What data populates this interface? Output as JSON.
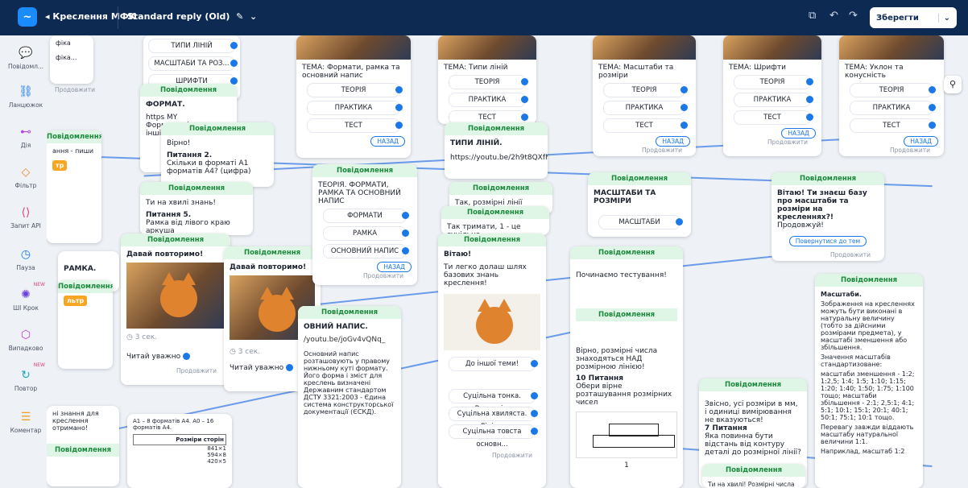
{
  "topbar": {
    "project": "Креслення МФК",
    "bot_name": "Standard reply (Old)",
    "save_label": "Зберегти"
  },
  "sidebar": [
    {
      "label": "Повідомл...",
      "icon": "chat-icon"
    },
    {
      "label": "Ланцюжок",
      "icon": "chain-icon"
    },
    {
      "label": "Дія",
      "icon": "action-icon"
    },
    {
      "label": "Фільтр",
      "icon": "filter-icon"
    },
    {
      "label": "Запит API",
      "icon": "api-icon"
    },
    {
      "label": "Пауза",
      "icon": "pause-icon"
    },
    {
      "label": "ШІ Крок",
      "icon": "ai-icon",
      "badge": "NEW"
    },
    {
      "label": "Випадково",
      "icon": "random-icon"
    },
    {
      "label": "Повтор",
      "icon": "repeat-icon",
      "badge": "NEW"
    },
    {
      "label": "Коментар",
      "icon": "comment-icon"
    }
  ],
  "common": {
    "message_header": "Повідомлення",
    "continue": "Продовжити",
    "back": "НАЗАД",
    "wait_3s": "3 сек."
  },
  "cards": {
    "lines_menu": [
      "ТИПИ ЛІНІЙ",
      "МАСШТАБИ ТА РОЗ...",
      "ШРИФТИ"
    ],
    "format_title": "ФОРМАТ.",
    "format_url": "https MY",
    "format_body": "Форм розмір якому інші ко",
    "vitayu_hint": "Вірно!",
    "q2_title": "Питання 2.",
    "q2_text": "Скільки в форматі А1 форматів А4? (цифра)",
    "on_wave": "Ти на хвилі знань!",
    "q5_title": "Питання 5.",
    "q5_text": "Рамка від лівого краю аркуша",
    "repeat_title": "Давай повторимо!",
    "read_carefully": "Читай уважно",
    "theme_formats": "ТЕМА: Формати, рамка та основний напис",
    "menu_tpt": [
      "ТЕОРІЯ",
      "ПРАКТИКА",
      "ТЕСТ"
    ],
    "theory_formats_title": "ТЕОРІЯ. ФОРМАТИ, РАМКА ТА ОСНОВНИЙ НАПИС",
    "theory_formats_menu": [
      "ФОРМАТИ",
      "РАМКА",
      "ОСНОВНИЙ НАПИС"
    ],
    "theme_lines": "ТЕМА: Типи ліній",
    "lines_types_title": "ТИПИ ЛІНІЙ.",
    "lines_url": "https://youtu.be/2h9t8QXfMl",
    "lines_note": "Так, розмірні лінії показує",
    "lines_note2": "Так тримати, 1 - це суцільна",
    "vitayu": "Вітаю!",
    "vitayu_text": "Ти легко долаш шлях базових знань креслення!",
    "another_topic": "До іншої теми!",
    "line_opts": [
      "Суцільна тонка. Виносні...",
      "Суцільна хвиляста. Лінія...",
      "Суцільна товста основн..."
    ],
    "theme_scale": "ТЕМА: Масштаби та розміри",
    "scale_title": "МАСШТАБИ ТА РОЗМІРИ",
    "scale_btn": "МАСШТАБИ",
    "start_test": "Починаємо тестування!",
    "correct_text": "Вірно, розмірні числа знаходяться НАД розмірною лінією!",
    "q10_title": "10 Питання",
    "q10_text": "Обери вірне розташування розмірних чисел",
    "theme_fonts": "ТЕМА: Шрифти",
    "theme_slope": "ТЕМА: Уклон та конусність",
    "greet_scale": "Вітаю! Ти знаєш базу про масштаби та розміри на кресленнях?!",
    "greet_cont": "Продовжуй!",
    "return_btn": "Повернутися до тем",
    "mm_text": "Звісно, усі розміри в мм, і одиниці вимірювання не вказуються!",
    "q7_title": "7 Питання",
    "q7_text": "Яка повинна бути відстань від контуру деталі до розмірної лінії?",
    "scale_info_title": "Масштаби.",
    "scale_info_1": "Зображення на кресленнях можуть бути виконані в натуральну величину (тобто за дійсними розмірами предмета), у масштабі зменшення або збільшення.",
    "scale_info_2": "Значення масштабів стандартизоване:",
    "scale_info_3": "масштаби зменшення - 1:2; 1:2,5; 1:4; 1:5; 1:10; 1:15; 1:20; 1:40; 1:50; 1:75; 1:100 тощо; масштаби збільшення - 2:1; 2,5:1; 4:1; 5:1; 10:1; 15:1; 20:1; 40:1; 50:1; 75:1; 10:1 тощо.",
    "scale_info_4": "Перевагу завжди віддають масштабу натуральної величини 1:1.",
    "scale_info_5": "Наприклад, масштаб 1:2",
    "main_inscription": "ОВНИЙ НАПИС.",
    "main_inscription_url": "/youtu.be/joGv4vQNq_",
    "main_inscription_text": "Основний напис розташовують у правому нижньому куті формату. Його форма і зміст для креслень визначені Державним стандартом ДСТУ 3321:2003 - Єдина система конструкторської документації (ЄСКД).",
    "frame_title": "РАМКА.",
    "last_hint": "Ти на хвилі! Розмірні числа",
    "tbl_head": "Розміри сторін",
    "tbl_rows": [
      "841×1",
      "594×8",
      "420×5",
      "297×4",
      "210×2"
    ],
    "a_formats": "А1 – 8 форматів А4. А0 – 16 форматів А4.",
    "knowledge_received": "ні знання для креслення отримано!",
    "num_1": "1"
  }
}
